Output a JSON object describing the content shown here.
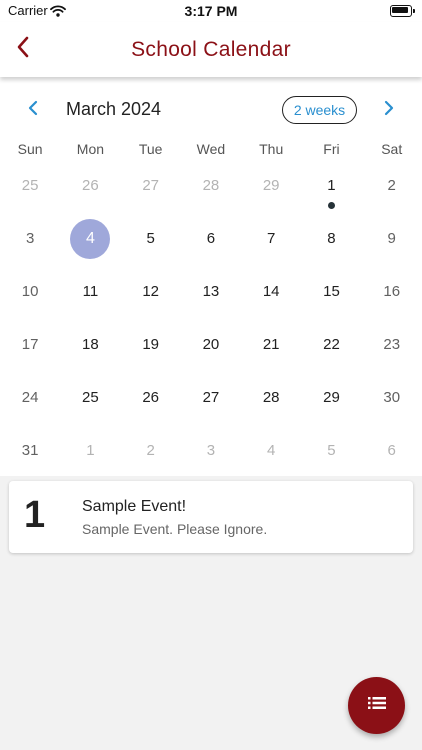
{
  "status_bar": {
    "carrier": "Carrier",
    "time": "3:17 PM"
  },
  "app_bar": {
    "title": "School Calendar"
  },
  "calendar": {
    "month": "March 2024",
    "format_label": "2 weeks",
    "weekdays": [
      "Sun",
      "Mon",
      "Tue",
      "Wed",
      "Thu",
      "Fri",
      "Sat"
    ],
    "weeks": [
      [
        "25",
        "26",
        "27",
        "28",
        "29",
        "1",
        "2"
      ],
      [
        "3",
        "4",
        "5",
        "6",
        "7",
        "8",
        "9"
      ],
      [
        "10",
        "11",
        "12",
        "13",
        "14",
        "15",
        "16"
      ],
      [
        "17",
        "18",
        "19",
        "20",
        "21",
        "22",
        "23"
      ],
      [
        "24",
        "25",
        "26",
        "27",
        "28",
        "29",
        "30"
      ],
      [
        "31",
        "1",
        "2",
        "3",
        "4",
        "5",
        "6"
      ]
    ],
    "selected_day": "4",
    "event_day": "1"
  },
  "event": {
    "day": "1",
    "title": "Sample Event!",
    "description": "Sample Event. Please Ignore."
  },
  "colors": {
    "accent": "#8b1016",
    "selected": "#9fa8da",
    "link": "#2a8fcf"
  },
  "icons": {
    "back": "chevron-left-icon",
    "prev": "chevron-left-icon",
    "next": "chevron-right-icon",
    "fab": "list-icon"
  }
}
